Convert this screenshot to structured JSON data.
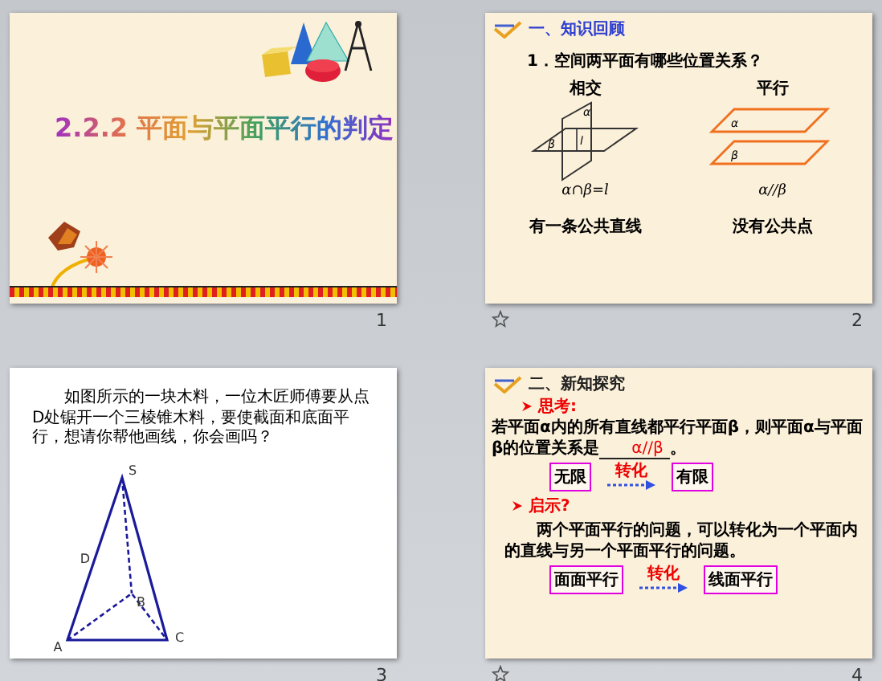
{
  "slides": [
    {
      "kind": "title",
      "number": "1",
      "animated": false,
      "title": "2.2.2 平面与平面平行的判定"
    },
    {
      "kind": "review",
      "number": "2",
      "animated": true,
      "heading": "一、知识回顾",
      "question": "1．空间两平面有哪些位置关系？",
      "cases": [
        {
          "kind": "intersecting",
          "label": "相交",
          "plane_labels": [
            "α",
            "β",
            "l"
          ],
          "formula": "α∩β=l",
          "caption": "有一条公共直线"
        },
        {
          "kind": "parallel",
          "label": "平行",
          "plane_labels": [
            "α",
            "β"
          ],
          "formula": "α//β",
          "caption": "没有公共点"
        }
      ]
    },
    {
      "kind": "problem",
      "number": "3",
      "animated": false,
      "text": "如图所示的一块木料，一位木匠师傅要从点D处锯开一个三棱锥木料，要使截面和底面平行，想请你帮他画线，你会画吗？",
      "points": [
        "S",
        "D",
        "B",
        "A",
        "C"
      ]
    },
    {
      "kind": "explore",
      "number": "4",
      "animated": true,
      "heading": "二、新知探究",
      "think": "思考:",
      "question": "若平面α内的所有直线都平行平面β，则平面α与平面β的位置关系是",
      "answer": "α//β",
      "end": "。",
      "pair1": {
        "from": "无限",
        "via": "转化",
        "to": "有限"
      },
      "hint": "启示?",
      "paragraph": "两个平面平行的问题，可以转化为一个平面内的直线与另一个平面平行的问题。",
      "pair2": {
        "from": "面面平行",
        "via": "转化",
        "to": "线面平行"
      }
    }
  ]
}
